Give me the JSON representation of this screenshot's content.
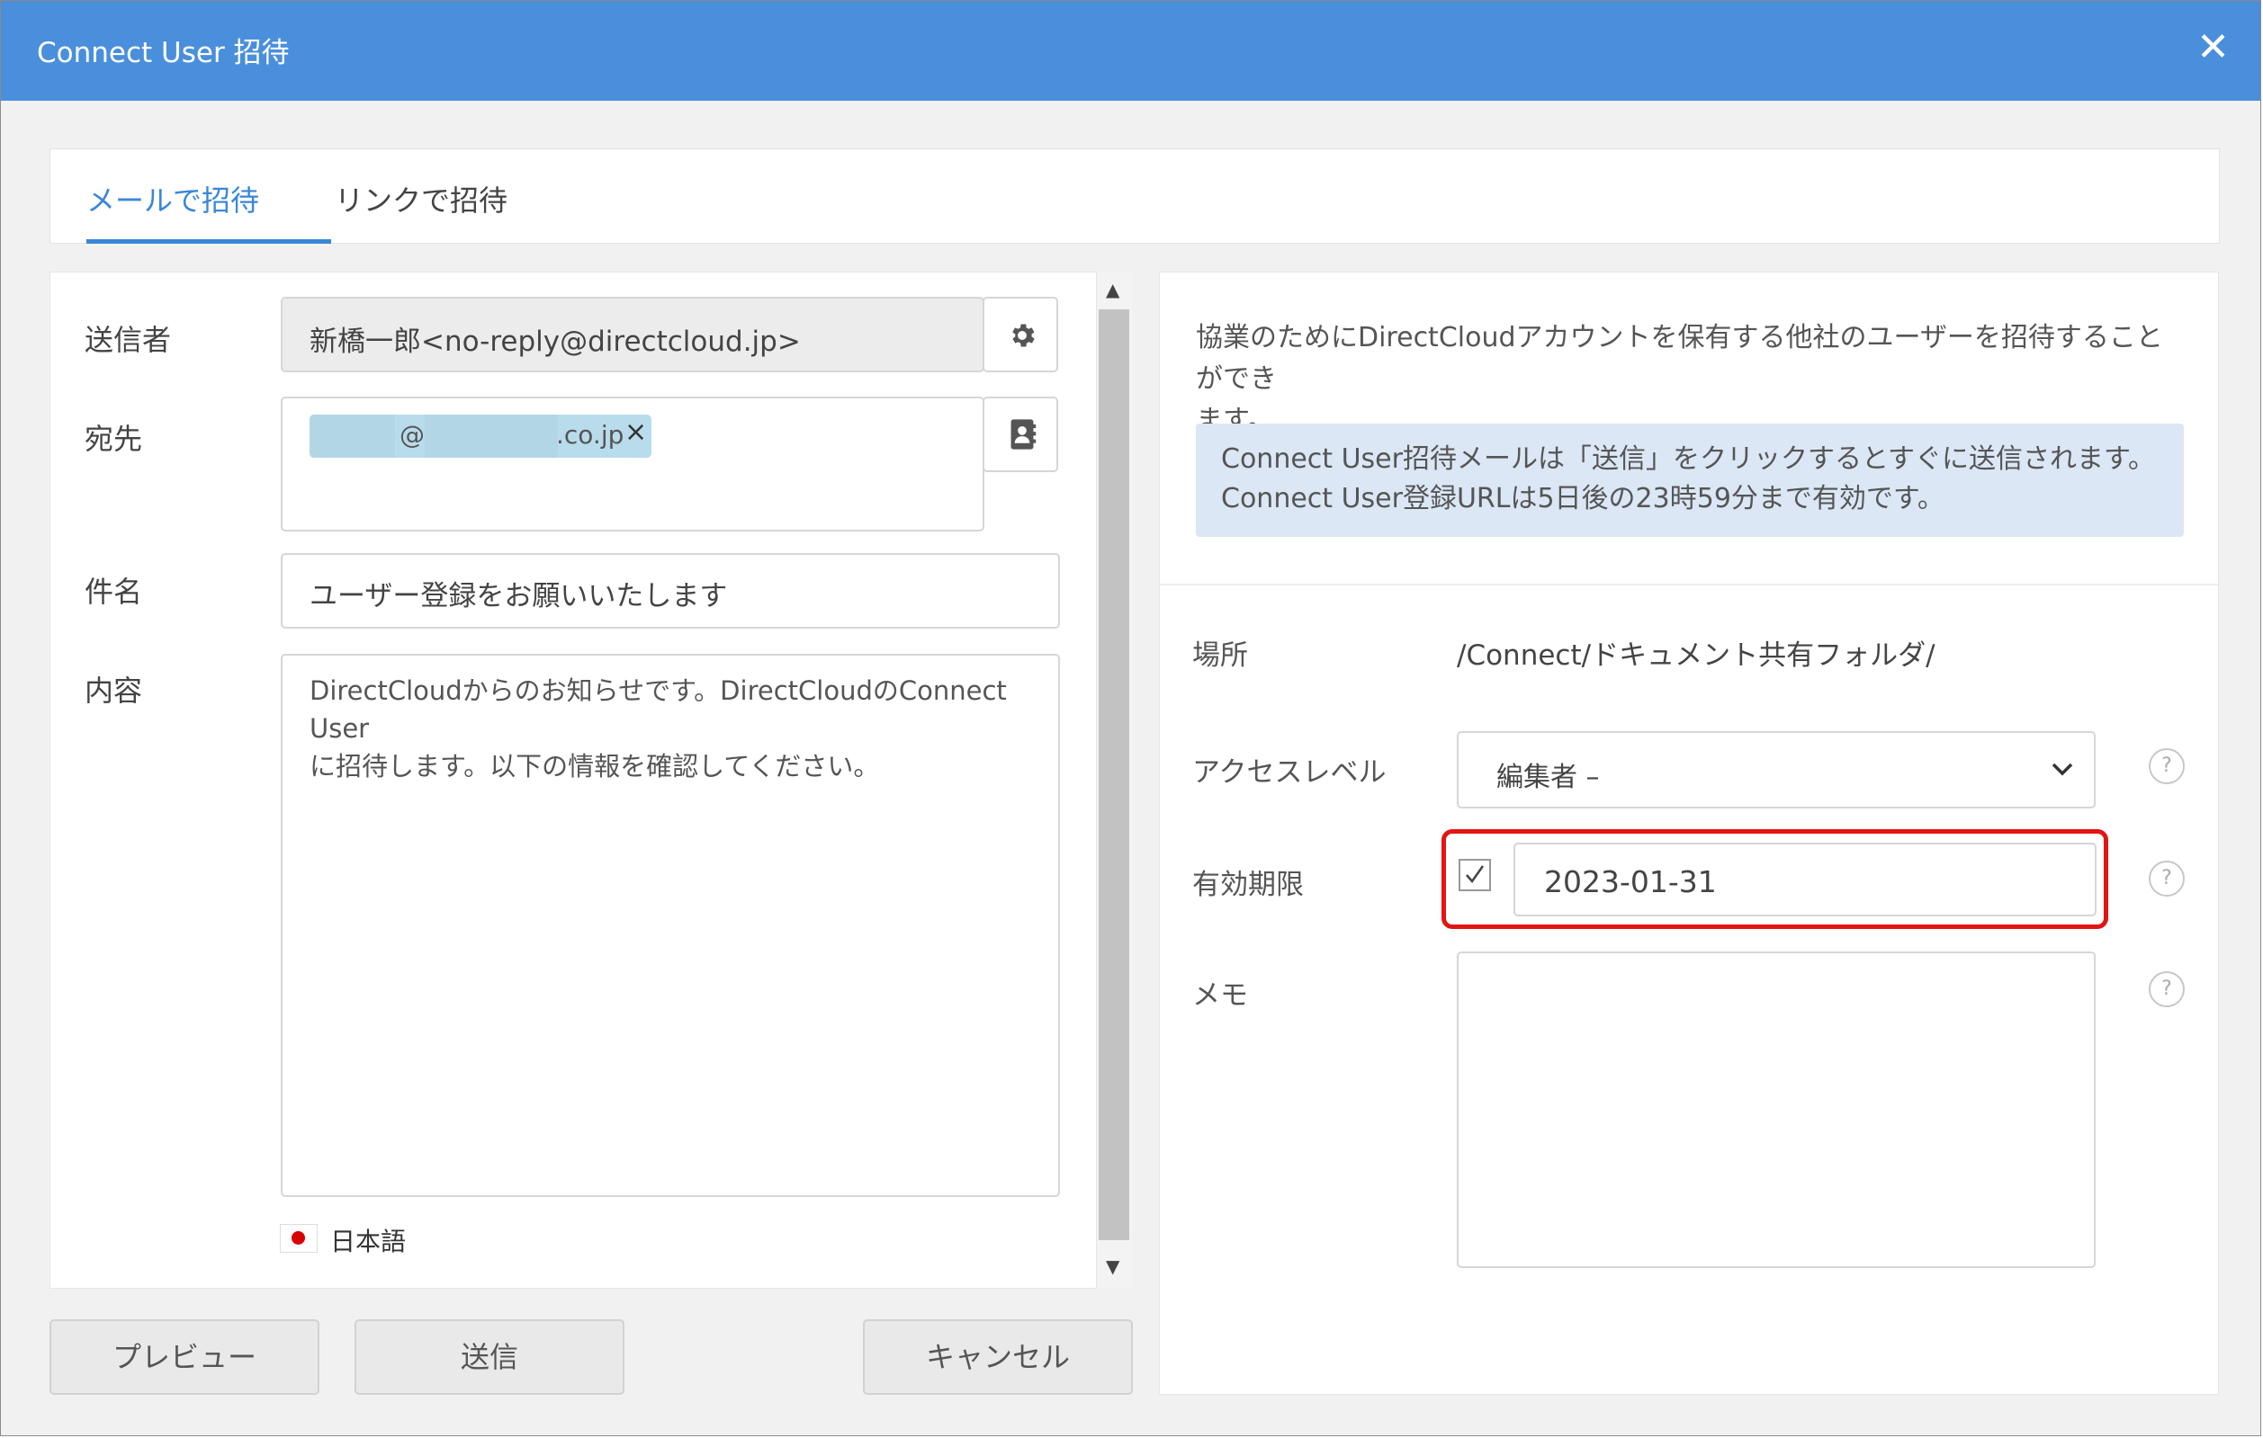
{
  "window": {
    "title": "Connect User 招待",
    "close_glyph": "✕"
  },
  "tabs": [
    {
      "label": "メールで招待",
      "active": true
    },
    {
      "label": "リンクで招待",
      "active": false
    }
  ],
  "form": {
    "sender": {
      "label": "送信者",
      "value": "新橋一郎<no-reply@directcloud.jp>",
      "settings_icon": "gear-icon"
    },
    "recipient": {
      "label": "宛先",
      "chip": {
        "at": "@",
        "domain": ".co.jp",
        "remove_glyph": "×"
      },
      "address_book_icon": "address-book-icon"
    },
    "subject": {
      "label": "件名",
      "value": "ユーザー登録をお願いいたします"
    },
    "content": {
      "label": "内容",
      "line1": "DirectCloudからのお知らせです。DirectCloudのConnect User",
      "line2": "に招待します。以下の情報を確認してください。"
    },
    "language": {
      "label": "日本語",
      "flag_icon": "japan-flag-icon"
    }
  },
  "buttons": {
    "preview": "プレビュー",
    "send": "送信",
    "cancel": "キャンセル"
  },
  "right": {
    "intro_line1": "協業のためにDirectCloudアカウントを保有する他社のユーザーを招待することができ",
    "intro_line2": "ます。",
    "info_line1": "Connect User招待メールは「送信」をクリックするとすぐに送信されます。",
    "info_line2": "Connect User登録URLは5日後の23時59分まで有効です。",
    "location": {
      "label": "場所",
      "value": "/Connect/ドキュメント共有フォルダ/"
    },
    "access_level": {
      "label": "アクセスレベル",
      "value": "編集者 –"
    },
    "expiry": {
      "label": "有効期限",
      "checked": true,
      "value": "2023-01-31"
    },
    "memo": {
      "label": "メモ",
      "value": ""
    },
    "help_glyph": "?"
  },
  "colors": {
    "titlebar": "#4a8fdb",
    "accent": "#3a87d8",
    "highlight": "#e21515",
    "info_bg": "#dbe7f5"
  }
}
